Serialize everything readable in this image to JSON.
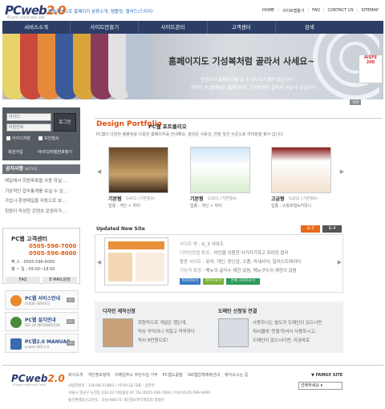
{
  "header": {
    "logo_main": "PCweb",
    "logo_ver": "2.0",
    "logo_sub": "PCweb community web",
    "tagline": "웹솔루션으로 홈페이지 분류소개, 템플릿, 캘러드(드리지!",
    "links": [
      "HOME",
      "사이트맵들기",
      "FAQ",
      "CONTACT US",
      "SITEMAP"
    ]
  },
  "nav": [
    "서비스소개",
    "사이트만들기",
    "사이트관리",
    "고객센터",
    "검색"
  ],
  "hero": {
    "headline": "홈페이지도 기성복처럼 골라서 사세요~",
    "line1": "한권이서 홈페이지를 살 수 있나요? 물론 없습니다.",
    "line2": "하지만 PC웹에서는 홈페이지도 기성복처럼 골라서 사실 수 있습니다.",
    "badge": "AISFE 200",
    "top_btn": "TOP"
  },
  "login": {
    "id_placeholder": "아이디",
    "pw_placeholder": "비밀번호",
    "button": "로그인",
    "save_id": "아이디저장",
    "secure": "보안접속",
    "join": "회원가입",
    "find": "아이디/비밀번호찾기"
  },
  "notice": {
    "title": "공지사항",
    "title_sub": "NOTICE",
    "items": [
      "메일에서 회원목록을 사용 하실 ...",
      "기본적인 접속통계를 보실 수 있...",
      "가입시 환영메일을 자동으로 보...",
      "회원이 작성한 콘텐츠 운영자가..."
    ]
  },
  "contact": {
    "title": "PC웹 고객센터",
    "phone1": "0505-596-7000",
    "phone2": "0505-596-8000",
    "fax": "팩  스 : 0505-596-6000",
    "hours": "평 ~ 일 : 09:00~18:00",
    "faq": "FAQ",
    "email": "E-MAIL상담"
  },
  "banners": [
    {
      "title": "PC웹 서비스안내",
      "sub": "GUIDE SERVICE",
      "go": "GO"
    },
    {
      "title": "PC웹 설치안내",
      "sub": "SET UP INFORMATION",
      "go": "GO"
    },
    {
      "title": "PC웹2.0 MANUAR",
      "sub": "pcweb VER 1.0",
      "go": "GO"
    }
  ],
  "portfolio": {
    "title": "Design Portfolio",
    "title2": "PC웹 포트폴리오",
    "desc": "PC웹이 다양한 템플릿을 이용한 홈페이지를 안내해요. 놀라운 사용성, 한발 앞선 수준으로 여러분을 찾아 갑니다.",
    "items": [
      {
        "name": "기본형",
        "code": "G401 (기본형A)",
        "kind": "업종 : 개인 > 취미"
      },
      {
        "name": "기본형",
        "code": "G301 (기본형A)",
        "kind": "업종 : 개인 > 취미"
      },
      {
        "name": "고급형",
        "code": "G202 (기본형A)",
        "kind": "업종 : 쇼핑포털&커뮤니"
      }
    ]
  },
  "updated": {
    "title": "Updated New Site",
    "g3": "G-3",
    "g4": "G-4",
    "rows": [
      {
        "label": "사이트 명 :",
        "value": "G_3 샤이즈"
      },
      {
        "label": "디자인컨셉 특징 :",
        "value": "라인을 이용한 아기자기하고 화려한 컬러"
      },
      {
        "label": "활용 사이트 :",
        "value": "유아, 개인, 장난감, 소품, 악세사리, 일러스트레이터"
      },
      {
        "label": "기능적 특징 :",
        "value": "메뉴의 글자수 제한 없음, 메뉴갯수의 제한이 없음"
      }
    ],
    "btns": [
      "이미지보기",
      "가이드보기",
      "전체 사이트보기"
    ]
  },
  "bottom": {
    "b1_title": "디자인 제작신청",
    "b1_text": [
      "회원작으로 개설은 했는데,",
      "막상 꾸미려니 귀찮고 막막하다",
      "쳐서 8만원으로!"
    ],
    "b2_title": "도메인 신청및 연결",
    "b2_text": [
      "사용하시는 별도의 도메인이 있으시면",
      "피씨웹에 '연결'하셔서 사용하시고,",
      "도메인이 없으시다면, 지금바로"
    ]
  },
  "footer": {
    "logo_main": "PCweb",
    "logo_ver": "2.0",
    "logo_sub": "PCweb community web",
    "links": [
      "회사소개",
      "개인정보정책",
      "이메일주소 무단수집 거부",
      "PC웹도움말",
      "SW웹업체제휴안내",
      "찾아오시는 길"
    ],
    "info1": "사업자번호 : 120-86-51883 / (주)투니휴 대표 : 김한주",
    "info2": "서울시 강남구 논현동 242-22 미림빌딩 4F TEL:0505-596-7000 / FAX:0505-596-6000",
    "info3": "통신판매업신고번호 : 강남-6667호 개인정보관리책임자:정형진",
    "family_label": "▼ FAMILY SITE",
    "family_value": "선택하세요 ▾"
  },
  "colors": {
    "nav": "#2c3e66",
    "accent": "#e05010",
    "login_bg": "#555b63"
  }
}
